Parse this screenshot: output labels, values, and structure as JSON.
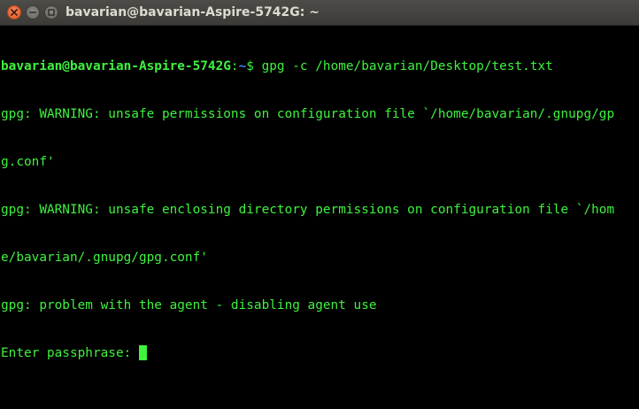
{
  "window": {
    "title": "bavarian@bavarian-Aspire-5742G: ~",
    "buttons": {
      "close": "close-icon",
      "minimize": "minimize-icon",
      "maximize": "maximize-icon"
    }
  },
  "terminal": {
    "prompt": {
      "user_host": "bavarian@bavarian-Aspire-5742G",
      "colon": ":",
      "path": "~",
      "symbol": "$ ",
      "command": "gpg -c /home/bavarian/Desktop/test.txt"
    },
    "output_lines": [
      "gpg: WARNING: unsafe permissions on configuration file `/home/bavarian/.gnupg/gp",
      "g.conf'",
      "gpg: WARNING: unsafe enclosing directory permissions on configuration file `/hom",
      "e/bavarian/.gnupg/gpg.conf'",
      "gpg: problem with the agent - disabling agent use"
    ],
    "input_prompt": "Enter passphrase: "
  },
  "colors": {
    "background": "#000000",
    "text": "#3ef23e",
    "path": "#3e8af2",
    "titlebar": "#3c3b37",
    "close_button": "#e0531f"
  }
}
